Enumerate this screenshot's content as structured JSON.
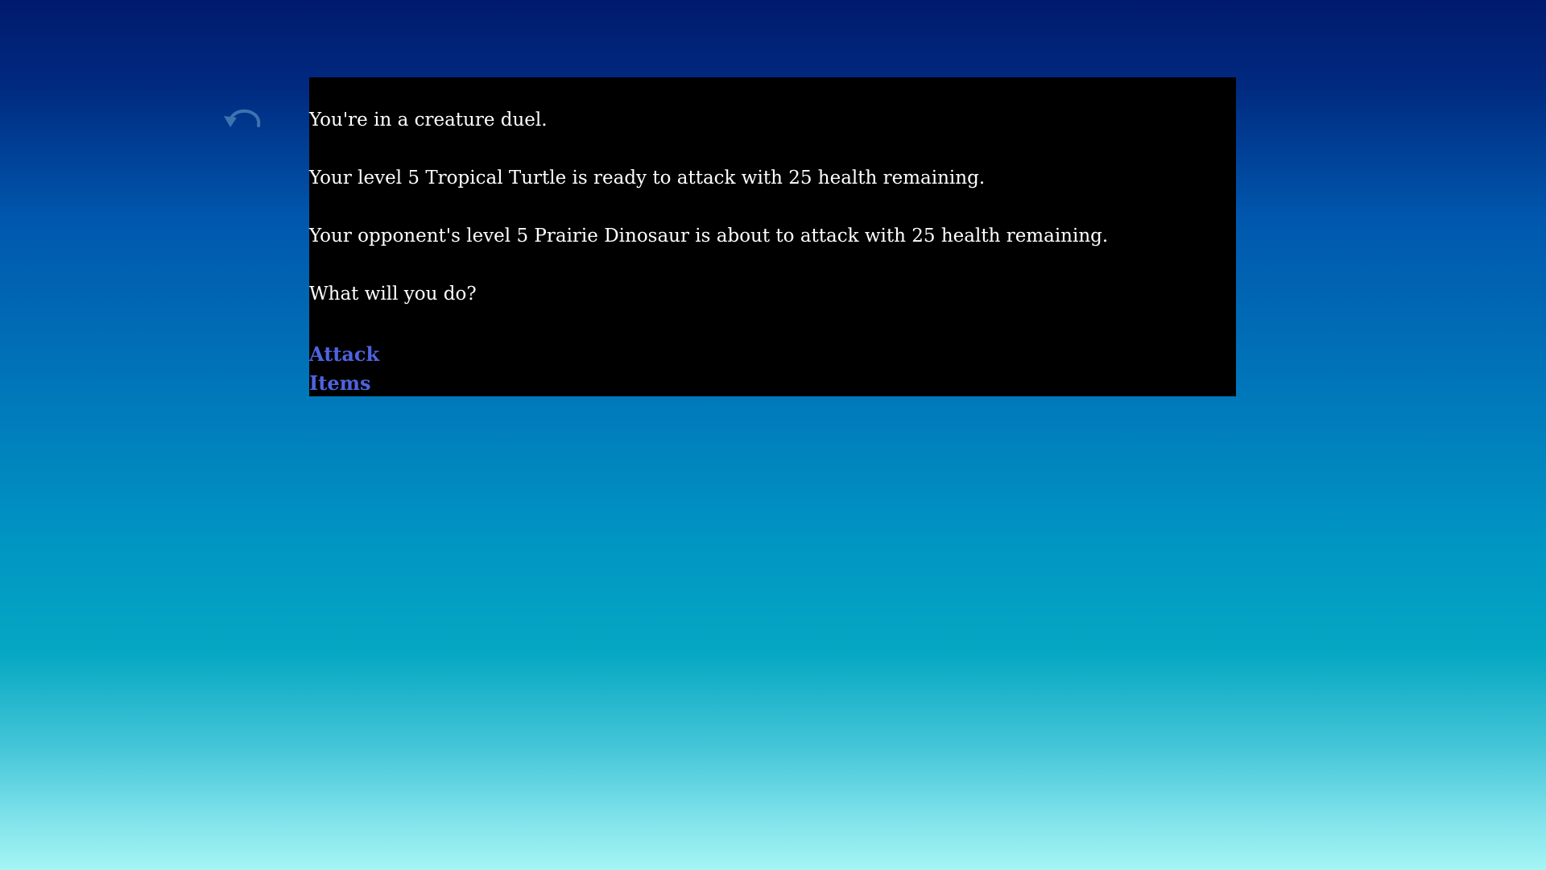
{
  "undo": {
    "icon": "undo-arrow-icon",
    "color": "#3e72b0"
  },
  "story": {
    "paragraphs": [
      "You're in a creature duel.",
      "Your level 5 Tropical Turtle is ready to attack with 25 health remaining.",
      "Your opponent's level 5 Prairie Dinosaur is about to attack with 25 health remaining.",
      "What will you do?"
    ],
    "choices": [
      "Attack",
      "Items"
    ]
  },
  "colors": {
    "panel_background": "#000000",
    "text": "#ffffff",
    "link": "#4f63e0"
  }
}
